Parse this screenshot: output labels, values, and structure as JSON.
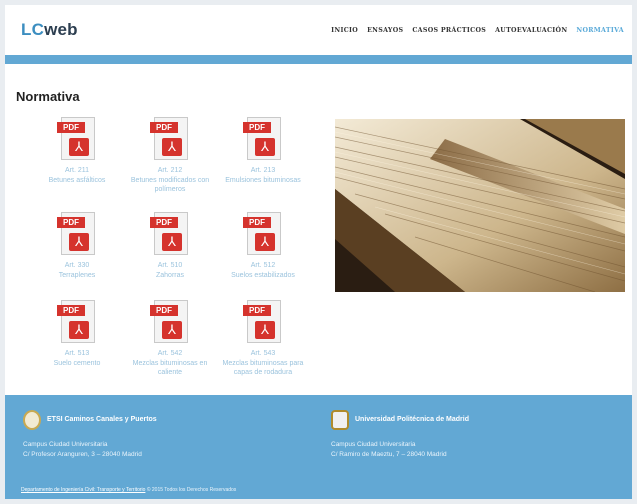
{
  "brand": {
    "part1": "LC",
    "part2": "web"
  },
  "nav": [
    {
      "label": "INICIO",
      "active": false
    },
    {
      "label": "ENSAYOS",
      "active": false
    },
    {
      "label": "CASOS PRÁCTICOS",
      "active": false
    },
    {
      "label": "AUTOEVALUACIÓN",
      "active": false
    },
    {
      "label": "NORMATIVA",
      "active": true
    }
  ],
  "page_title": "Normativa",
  "pdf_tag": "PDF",
  "docs": [
    {
      "line1": "Art. 211",
      "line2": "Betunes asfálticos"
    },
    {
      "line1": "Art. 212",
      "line2": "Betunes modificados con polímeros"
    },
    {
      "line1": "Art. 213",
      "line2": "Emulsiones bituminosas"
    },
    {
      "line1": "Art. 330",
      "line2": "Terraplenes"
    },
    {
      "line1": "Art. 510",
      "line2": "Zahorras"
    },
    {
      "line1": "Art. 512",
      "line2": "Suelos estabilizados"
    },
    {
      "line1": "Art. 513",
      "line2": "Suelo cemento"
    },
    {
      "line1": "Art. 542",
      "line2": "Mezclas bituminosas en caliente"
    },
    {
      "line1": "Art. 543",
      "line2": "Mezclas bituminosas para capas de rodadura"
    }
  ],
  "footer": {
    "school_name": "ETSI Caminos Canales y Puertos",
    "school_addr1": "Campus Ciudad Universitaria",
    "school_addr2": "C/ Profesor Aranguren, 3 – 28040 Madrid",
    "univ_name": "Universidad Politécnica de Madrid",
    "univ_addr1": "Campus Ciudad Universitaria",
    "univ_addr2": "C/ Ramiro de Maeztu, 7 – 28040 Madrid",
    "dept_link": "Departamento de Ingeniería Civil: Transporte y Territorio",
    "copyright": "© 2015 Todos los Derechos Reservados"
  },
  "colors": {
    "accent": "#62a8d4",
    "pdf_red": "#d5332d",
    "caption": "#9bc3dd"
  }
}
